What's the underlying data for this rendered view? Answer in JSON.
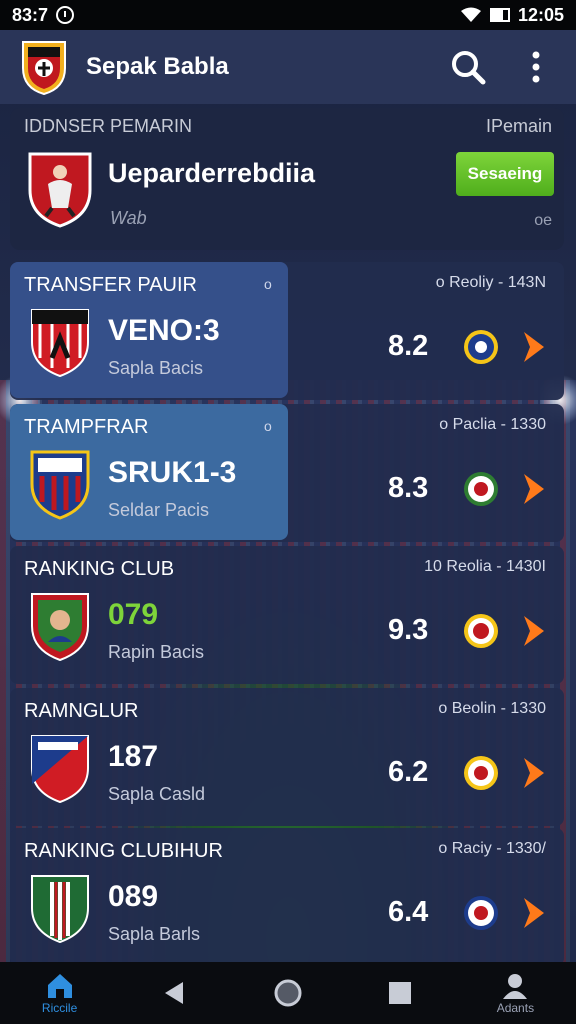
{
  "status_bar": {
    "time_left": "83:7",
    "time_right": "12:05"
  },
  "app_bar": {
    "title": "Sepak Babla"
  },
  "featured": {
    "label_left": "IDDNSER PEMARIN",
    "label_right": "IPemain",
    "name": "Ueparderrebdiia",
    "sub": "Wab",
    "button": "Sesaeing",
    "meta": "oe"
  },
  "cards": [
    {
      "title": "TRANSFER PAUIR",
      "dot": "o",
      "rinfo": "o   Reoliy - 143N",
      "score": "VENO:3",
      "sub": "Sapla Bacis",
      "rate": "8.2"
    },
    {
      "title": "TRAMPFRAR",
      "dot": "o",
      "rinfo": "o   Paclia - 1330",
      "score": "SRUK1-3",
      "sub": "Seldar Pacis",
      "rate": "8.3"
    },
    {
      "title": "RANKING CLUB",
      "dot": "",
      "rinfo": "10   Reolia - 1430I",
      "score": "079",
      "sub": "Rapin Bacis",
      "rate": "9.3"
    },
    {
      "title": "RAMNGLUR",
      "dot": "",
      "rinfo": "o   Beolin - 1330",
      "score": "187",
      "sub": "Sapla Casld",
      "rate": "6.2"
    },
    {
      "title": "RANKING CLUBIHUR",
      "dot": "",
      "rinfo": "o   Raciy - 1330/",
      "score": "089",
      "sub": "Sapla Barls",
      "rate": "6.4"
    }
  ],
  "nav": {
    "home_label": "Riccile",
    "account_label": "Adants"
  },
  "colors": {
    "accent_green": "#7ed43a",
    "accent_orange": "#ff7a1a",
    "nav_active": "#2f8fe0"
  }
}
